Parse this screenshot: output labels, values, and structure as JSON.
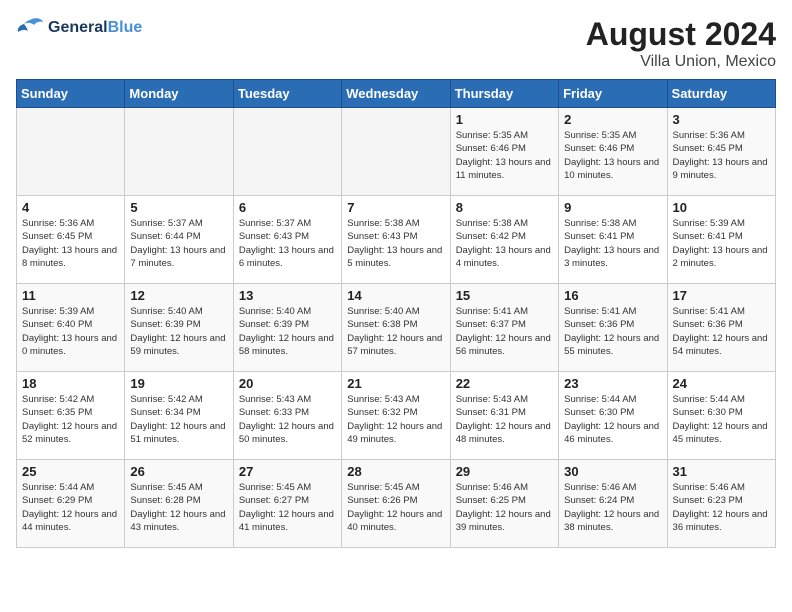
{
  "header": {
    "logo_line1": "General",
    "logo_line2": "Blue",
    "month_year": "August 2024",
    "location": "Villa Union, Mexico"
  },
  "weekdays": [
    "Sunday",
    "Monday",
    "Tuesday",
    "Wednesday",
    "Thursday",
    "Friday",
    "Saturday"
  ],
  "weeks": [
    [
      {
        "day": "",
        "info": ""
      },
      {
        "day": "",
        "info": ""
      },
      {
        "day": "",
        "info": ""
      },
      {
        "day": "",
        "info": ""
      },
      {
        "day": "1",
        "info": "Sunrise: 5:35 AM\nSunset: 6:46 PM\nDaylight: 13 hours\nand 11 minutes."
      },
      {
        "day": "2",
        "info": "Sunrise: 5:35 AM\nSunset: 6:46 PM\nDaylight: 13 hours\nand 10 minutes."
      },
      {
        "day": "3",
        "info": "Sunrise: 5:36 AM\nSunset: 6:45 PM\nDaylight: 13 hours\nand 9 minutes."
      }
    ],
    [
      {
        "day": "4",
        "info": "Sunrise: 5:36 AM\nSunset: 6:45 PM\nDaylight: 13 hours\nand 8 minutes."
      },
      {
        "day": "5",
        "info": "Sunrise: 5:37 AM\nSunset: 6:44 PM\nDaylight: 13 hours\nand 7 minutes."
      },
      {
        "day": "6",
        "info": "Sunrise: 5:37 AM\nSunset: 6:43 PM\nDaylight: 13 hours\nand 6 minutes."
      },
      {
        "day": "7",
        "info": "Sunrise: 5:38 AM\nSunset: 6:43 PM\nDaylight: 13 hours\nand 5 minutes."
      },
      {
        "day": "8",
        "info": "Sunrise: 5:38 AM\nSunset: 6:42 PM\nDaylight: 13 hours\nand 4 minutes."
      },
      {
        "day": "9",
        "info": "Sunrise: 5:38 AM\nSunset: 6:41 PM\nDaylight: 13 hours\nand 3 minutes."
      },
      {
        "day": "10",
        "info": "Sunrise: 5:39 AM\nSunset: 6:41 PM\nDaylight: 13 hours\nand 2 minutes."
      }
    ],
    [
      {
        "day": "11",
        "info": "Sunrise: 5:39 AM\nSunset: 6:40 PM\nDaylight: 13 hours\nand 0 minutes."
      },
      {
        "day": "12",
        "info": "Sunrise: 5:40 AM\nSunset: 6:39 PM\nDaylight: 12 hours\nand 59 minutes."
      },
      {
        "day": "13",
        "info": "Sunrise: 5:40 AM\nSunset: 6:39 PM\nDaylight: 12 hours\nand 58 minutes."
      },
      {
        "day": "14",
        "info": "Sunrise: 5:40 AM\nSunset: 6:38 PM\nDaylight: 12 hours\nand 57 minutes."
      },
      {
        "day": "15",
        "info": "Sunrise: 5:41 AM\nSunset: 6:37 PM\nDaylight: 12 hours\nand 56 minutes."
      },
      {
        "day": "16",
        "info": "Sunrise: 5:41 AM\nSunset: 6:36 PM\nDaylight: 12 hours\nand 55 minutes."
      },
      {
        "day": "17",
        "info": "Sunrise: 5:41 AM\nSunset: 6:36 PM\nDaylight: 12 hours\nand 54 minutes."
      }
    ],
    [
      {
        "day": "18",
        "info": "Sunrise: 5:42 AM\nSunset: 6:35 PM\nDaylight: 12 hours\nand 52 minutes."
      },
      {
        "day": "19",
        "info": "Sunrise: 5:42 AM\nSunset: 6:34 PM\nDaylight: 12 hours\nand 51 minutes."
      },
      {
        "day": "20",
        "info": "Sunrise: 5:43 AM\nSunset: 6:33 PM\nDaylight: 12 hours\nand 50 minutes."
      },
      {
        "day": "21",
        "info": "Sunrise: 5:43 AM\nSunset: 6:32 PM\nDaylight: 12 hours\nand 49 minutes."
      },
      {
        "day": "22",
        "info": "Sunrise: 5:43 AM\nSunset: 6:31 PM\nDaylight: 12 hours\nand 48 minutes."
      },
      {
        "day": "23",
        "info": "Sunrise: 5:44 AM\nSunset: 6:30 PM\nDaylight: 12 hours\nand 46 minutes."
      },
      {
        "day": "24",
        "info": "Sunrise: 5:44 AM\nSunset: 6:30 PM\nDaylight: 12 hours\nand 45 minutes."
      }
    ],
    [
      {
        "day": "25",
        "info": "Sunrise: 5:44 AM\nSunset: 6:29 PM\nDaylight: 12 hours\nand 44 minutes."
      },
      {
        "day": "26",
        "info": "Sunrise: 5:45 AM\nSunset: 6:28 PM\nDaylight: 12 hours\nand 43 minutes."
      },
      {
        "day": "27",
        "info": "Sunrise: 5:45 AM\nSunset: 6:27 PM\nDaylight: 12 hours\nand 41 minutes."
      },
      {
        "day": "28",
        "info": "Sunrise: 5:45 AM\nSunset: 6:26 PM\nDaylight: 12 hours\nand 40 minutes."
      },
      {
        "day": "29",
        "info": "Sunrise: 5:46 AM\nSunset: 6:25 PM\nDaylight: 12 hours\nand 39 minutes."
      },
      {
        "day": "30",
        "info": "Sunrise: 5:46 AM\nSunset: 6:24 PM\nDaylight: 12 hours\nand 38 minutes."
      },
      {
        "day": "31",
        "info": "Sunrise: 5:46 AM\nSunset: 6:23 PM\nDaylight: 12 hours\nand 36 minutes."
      }
    ]
  ]
}
